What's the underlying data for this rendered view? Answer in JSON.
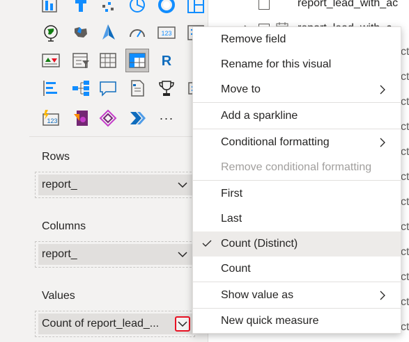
{
  "viz_icons": [
    "stacked-bar-icon",
    "stacked-column-icon",
    "scatter-icon",
    "pie-icon",
    "donut-icon",
    "treemap-icon",
    "map-icon",
    "filled-map-icon",
    "azure-map-icon",
    "gauge-icon",
    "card-icon",
    "multirow-card-icon",
    "kpi-icon",
    "slicer-icon",
    "table-icon",
    "matrix-icon",
    "r-visual-icon",
    "python-visual-icon",
    "decomposition-tree-icon",
    "key-influencers-icon",
    "qna-icon",
    "paginated-report-icon",
    "trophy-icon",
    "smart-narrative-icon",
    "metrics-icon",
    "power-apps-icon",
    "power-automate-icon",
    "more-visuals-icon"
  ],
  "more_glyph": "···",
  "wells": {
    "rows": {
      "label": "Rows",
      "field": "report_"
    },
    "columns": {
      "label": "Columns",
      "field": "report_"
    },
    "values": {
      "label": "Values",
      "field": "Count of report_lead_..."
    }
  },
  "fields_pane": {
    "items": [
      "report_lead_with_ac",
      "report_lead_with_c"
    ],
    "suffix": "ct"
  },
  "context_menu": {
    "items": [
      {
        "label": "Remove field"
      },
      {
        "label": "Rename for this visual"
      },
      {
        "label": "Move to"
      },
      {
        "label": "Add a sparkline"
      },
      {
        "label": "Conditional formatting"
      },
      {
        "label": "Remove conditional formatting"
      },
      {
        "label": "First"
      },
      {
        "label": "Last"
      },
      {
        "label": "Count (Distinct)"
      },
      {
        "label": "Count"
      },
      {
        "label": "Show value as"
      },
      {
        "label": "New quick measure"
      }
    ],
    "checked_item": "Count (Distinct)",
    "disabled_item": "Remove conditional formatting"
  },
  "colors": {
    "accent": "#0f6cbd",
    "highlight_border": "#e81123",
    "menu_hover": "#edebe9"
  }
}
